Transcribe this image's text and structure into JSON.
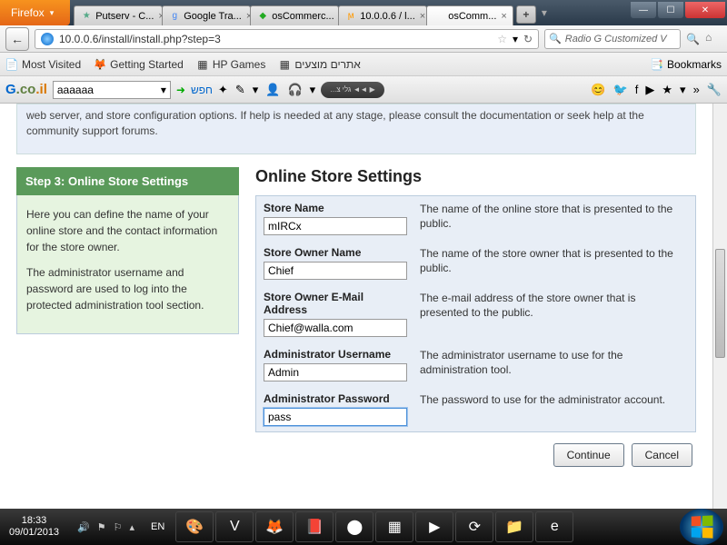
{
  "titlebar": {
    "firefox_label": "Firefox",
    "tabs": [
      {
        "label": "Putserv - C...",
        "fav": "★",
        "fav_color": "#5a8"
      },
      {
        "label": "Google Tra...",
        "fav": "g",
        "fav_color": "#4285f4"
      },
      {
        "label": "osCommerc...",
        "fav": "◆",
        "fav_color": "#2a2"
      },
      {
        "label": "10.0.0.6 / l...",
        "fav": "ϻ",
        "fav_color": "#f90"
      },
      {
        "label": "osComm...",
        "fav": "",
        "fav_color": "",
        "active": true
      }
    ],
    "newtab": "+",
    "sep": "▾",
    "min": "—",
    "max": "☐",
    "close": "✕"
  },
  "nav": {
    "back": "←",
    "url": "10.0.0.6/install/install.php?step=3",
    "star": "☆",
    "dd": "▾",
    "reload": "↻",
    "search_placeholder": "Radio G Customized V",
    "home": "⌂",
    "mag": "🔍"
  },
  "bookmarks": {
    "items": [
      {
        "icon": "📄",
        "label": "Most Visited"
      },
      {
        "icon": "🦊",
        "label": "Getting Started"
      },
      {
        "icon": "▦",
        "label": "HP Games"
      },
      {
        "icon": "▦",
        "label": "אתרים מוצעים"
      }
    ],
    "right_icon": "📑",
    "right_label": "Bookmarks"
  },
  "gtb": {
    "logo": [
      "G",
      ".co",
      ".il"
    ],
    "box": "aaaaaa",
    "btn": "חפש",
    "icons": [
      "✦",
      "✎",
      "▾",
      "👤",
      "🎧",
      "▾"
    ],
    "media": "...גלי צ ◄◄ ▶",
    "tail": [
      "😊",
      "🐦",
      "f",
      "▶",
      "★",
      "▾",
      "»",
      "🔧"
    ]
  },
  "info": "web server, and store configuration options. If help is needed at any stage, please consult the documentation or seek help at the community support forums.",
  "side": {
    "title": "Step 3: Online Store Settings",
    "p1": "Here you can define the name of your online store and the contact information for the store owner.",
    "p2": "The administrator username and password are used to log into the protected administration tool section."
  },
  "main": {
    "title": "Online Store Settings",
    "fields": [
      {
        "label": "Store Name",
        "value": "mIRCx",
        "desc": "The name of the online store that is presented to the public."
      },
      {
        "label": "Store Owner Name",
        "value": "Chief",
        "desc": "The name of the store owner that is presented to the public."
      },
      {
        "label": "Store Owner E-Mail Address",
        "value": "Chief@walla.com",
        "desc": "The e-mail address of the store owner that is presented to the public."
      },
      {
        "label": "Administrator Username",
        "value": "Admin",
        "desc": "The administrator username to use for the administration tool."
      },
      {
        "label": "Administrator Password",
        "value": "pass",
        "desc": "The password to use for the administrator account.",
        "focus": true
      }
    ],
    "continue": "Continue",
    "cancel": "Cancel"
  },
  "taskbar": {
    "time": "18:33",
    "date": "09/01/2013",
    "tray": [
      "🔊",
      "⚑",
      "⚐",
      "▴"
    ],
    "lang": "EN",
    "tasks": [
      "🎨",
      "V",
      "🦊",
      "📕",
      "⬤",
      "▦",
      "▶",
      "⟳",
      "📁",
      "e"
    ]
  }
}
